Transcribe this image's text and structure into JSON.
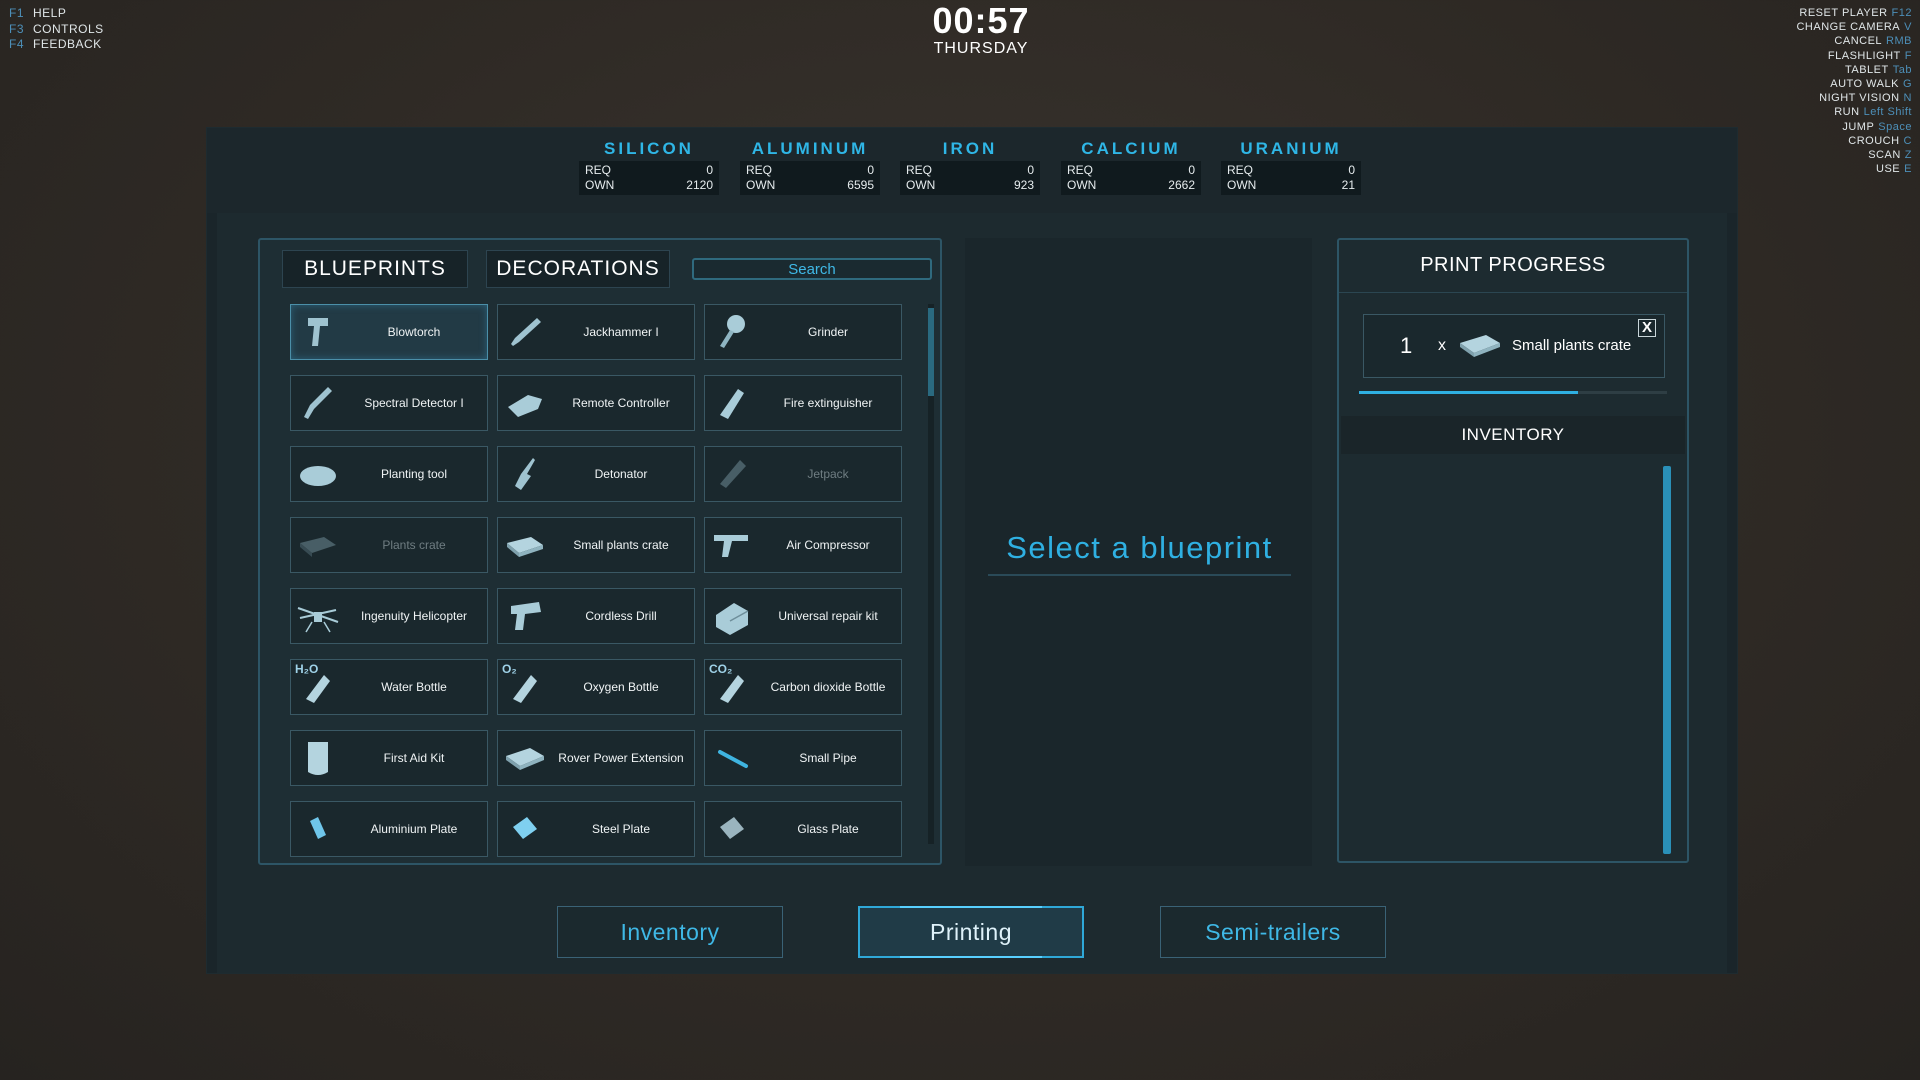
{
  "hud_left": [
    {
      "key": "F1",
      "label": "HELP"
    },
    {
      "key": "F3",
      "label": "CONTROLS"
    },
    {
      "key": "F4",
      "label": "FEEDBACK"
    }
  ],
  "clock": {
    "time": "00:57",
    "day": "THURSDAY"
  },
  "hud_right": [
    {
      "label": "RESET PLAYER",
      "key": "F12"
    },
    {
      "label": "CHANGE CAMERA",
      "key": "V"
    },
    {
      "label": "CANCEL",
      "key": "RMB"
    },
    {
      "label": "FLASHLIGHT",
      "key": "F"
    },
    {
      "label": "TABLET",
      "key": "Tab"
    },
    {
      "label": "AUTO WALK",
      "key": "G"
    },
    {
      "label": "NIGHT VISION",
      "key": "N"
    },
    {
      "label": "RUN",
      "key": "Left Shift"
    },
    {
      "label": "JUMP",
      "key": "Space"
    },
    {
      "label": "CROUCH",
      "key": "C"
    },
    {
      "label": "SCAN",
      "key": "Z"
    },
    {
      "label": "USE",
      "key": "E"
    }
  ],
  "resources": [
    {
      "name": "SILICON",
      "req_label": "REQ",
      "req": "0",
      "own_label": "OWN",
      "own": "2120"
    },
    {
      "name": "ALUMINUM",
      "req_label": "REQ",
      "req": "0",
      "own_label": "OWN",
      "own": "6595"
    },
    {
      "name": "IRON",
      "req_label": "REQ",
      "req": "0",
      "own_label": "OWN",
      "own": "923"
    },
    {
      "name": "CALCIUM",
      "req_label": "REQ",
      "req": "0",
      "own_label": "OWN",
      "own": "2662"
    },
    {
      "name": "URANIUM",
      "req_label": "REQ",
      "req": "0",
      "own_label": "OWN",
      "own": "21"
    }
  ],
  "tabs": {
    "blueprints": "BLUEPRINTS",
    "decorations": "DECORATIONS",
    "search": "Search"
  },
  "blueprints": [
    {
      "label": "Blowtorch",
      "icon": "blowtorch-icon",
      "selected": true
    },
    {
      "label": "Jackhammer I",
      "icon": "jackhammer-icon"
    },
    {
      "label": "Grinder",
      "icon": "grinder-icon"
    },
    {
      "label": "Spectral Detector I",
      "icon": "spectral-detector-icon"
    },
    {
      "label": "Remote Controller",
      "icon": "remote-controller-icon"
    },
    {
      "label": "Fire extinguisher",
      "icon": "fire-extinguisher-icon"
    },
    {
      "label": "Planting tool",
      "icon": "planting-tool-icon"
    },
    {
      "label": "Detonator",
      "icon": "detonator-icon"
    },
    {
      "label": "Jetpack",
      "icon": "jetpack-icon",
      "disabled": true
    },
    {
      "label": "Plants crate",
      "icon": "plants-crate-icon",
      "disabled": true
    },
    {
      "label": "Small plants crate",
      "icon": "small-plants-crate-icon"
    },
    {
      "label": "Air Compressor",
      "icon": "air-compressor-icon"
    },
    {
      "label": "Ingenuity Helicopter",
      "icon": "helicopter-icon"
    },
    {
      "label": "Cordless Drill",
      "icon": "drill-icon"
    },
    {
      "label": "Universal repair kit",
      "icon": "repair-kit-icon"
    },
    {
      "label": "Water Bottle",
      "icon": "water-bottle-icon",
      "chem": "H₂O"
    },
    {
      "label": "Oxygen Bottle",
      "icon": "oxygen-bottle-icon",
      "chem": "O₂"
    },
    {
      "label": "Carbon dioxide Bottle",
      "icon": "co2-bottle-icon",
      "chem": "CO₂"
    },
    {
      "label": "First Aid Kit",
      "icon": "first-aid-kit-icon"
    },
    {
      "label": "Rover Power Extension",
      "icon": "rover-power-icon"
    },
    {
      "label": "Small Pipe",
      "icon": "pipe-icon"
    },
    {
      "label": "Aluminium Plate",
      "icon": "aluminium-plate-icon"
    },
    {
      "label": "Steel Plate",
      "icon": "steel-plate-icon"
    },
    {
      "label": "Glass Plate",
      "icon": "glass-plate-icon"
    }
  ],
  "center": {
    "prompt": "Select a blueprint"
  },
  "print_progress": {
    "title": "PRINT PROGRESS",
    "job": {
      "qty": "1",
      "x": "x",
      "name": "Small plants crate",
      "close": "X"
    },
    "progress": 0.71,
    "inventory_title": "INVENTORY"
  },
  "bottom_tabs": [
    {
      "label": "Inventory",
      "active": false
    },
    {
      "label": "Printing",
      "active": true
    },
    {
      "label": "Semi-trailers",
      "active": false
    }
  ],
  "colors": {
    "accent": "#2fb6e6",
    "panel": "#1d2a2f",
    "border": "#2d5566"
  }
}
